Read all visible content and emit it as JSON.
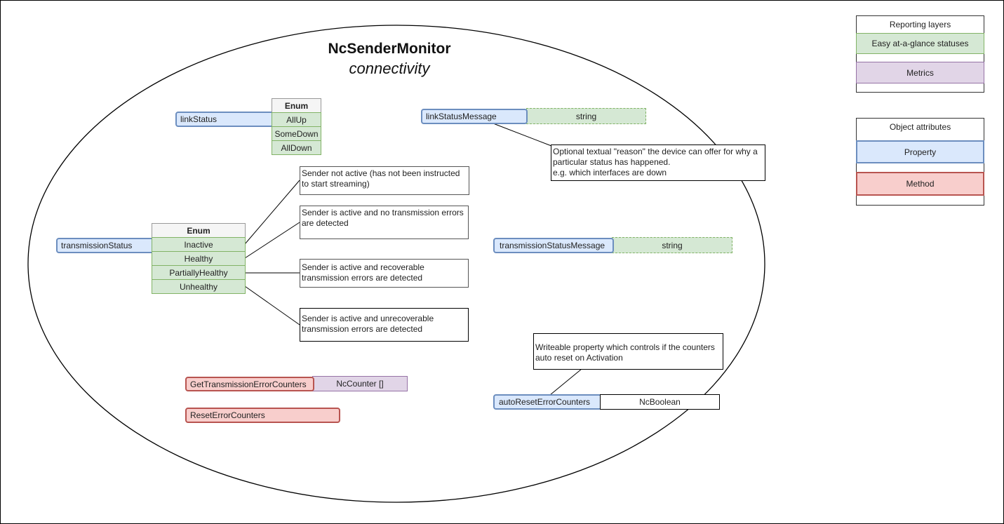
{
  "diagram": {
    "title": "NcSenderMonitor",
    "subtitle": "connectivity"
  },
  "properties": {
    "link_status": {
      "name": "linkStatus",
      "type_header": "Enum",
      "values": [
        "AllUp",
        "SomeDown",
        "AllDown"
      ]
    },
    "link_status_message": {
      "name": "linkStatusMessage",
      "type": "string",
      "note": " Optional textual \"reason\" the device can offer for why a particular status has happened.\ne.g. which interfaces are down"
    },
    "transmission_status": {
      "name": "transmissionStatus",
      "type_header": "Enum",
      "values": [
        "Inactive",
        "Healthy",
        "PartiallyHealthy",
        "Unhealthy"
      ],
      "notes": [
        "Sender not active (has not been instructed to start streaming)",
        "Sender is active and no transmission errors are detected",
        "Sender is active and recoverable transmission errors are detected",
        "Sender is active and unrecoverable transmission errors are detected"
      ]
    },
    "transmission_status_message": {
      "name": "transmissionStatusMessage",
      "type": "string"
    },
    "auto_reset_error_counters": {
      "name": "autoResetErrorCounters",
      "type": "NcBoolean",
      "note": " Writeable property which controls if the counters auto reset on Activation"
    }
  },
  "methods": {
    "get_transmission_error_counters": {
      "name": "GetTransmissionErrorCounters",
      "returns": "NcCounter []"
    },
    "reset_error_counters": {
      "name": "ResetErrorCounters"
    }
  },
  "legends": {
    "reporting_layers": {
      "title": "Reporting layers",
      "items": [
        "Easy at-a-glance statuses",
        "Metrics"
      ]
    },
    "object_attributes": {
      "title": "Object attributes",
      "items": [
        "Property",
        "Method"
      ]
    }
  },
  "colors": {
    "property_fill": "#dae8fc",
    "property_stroke": "#6c8ebf",
    "method_fill": "#f8cecc",
    "method_stroke": "#b85450",
    "status_fill": "#d5e8d4",
    "status_stroke": "#82b366",
    "metric_fill": "#e1d5e7",
    "metric_stroke": "#9673a6"
  }
}
